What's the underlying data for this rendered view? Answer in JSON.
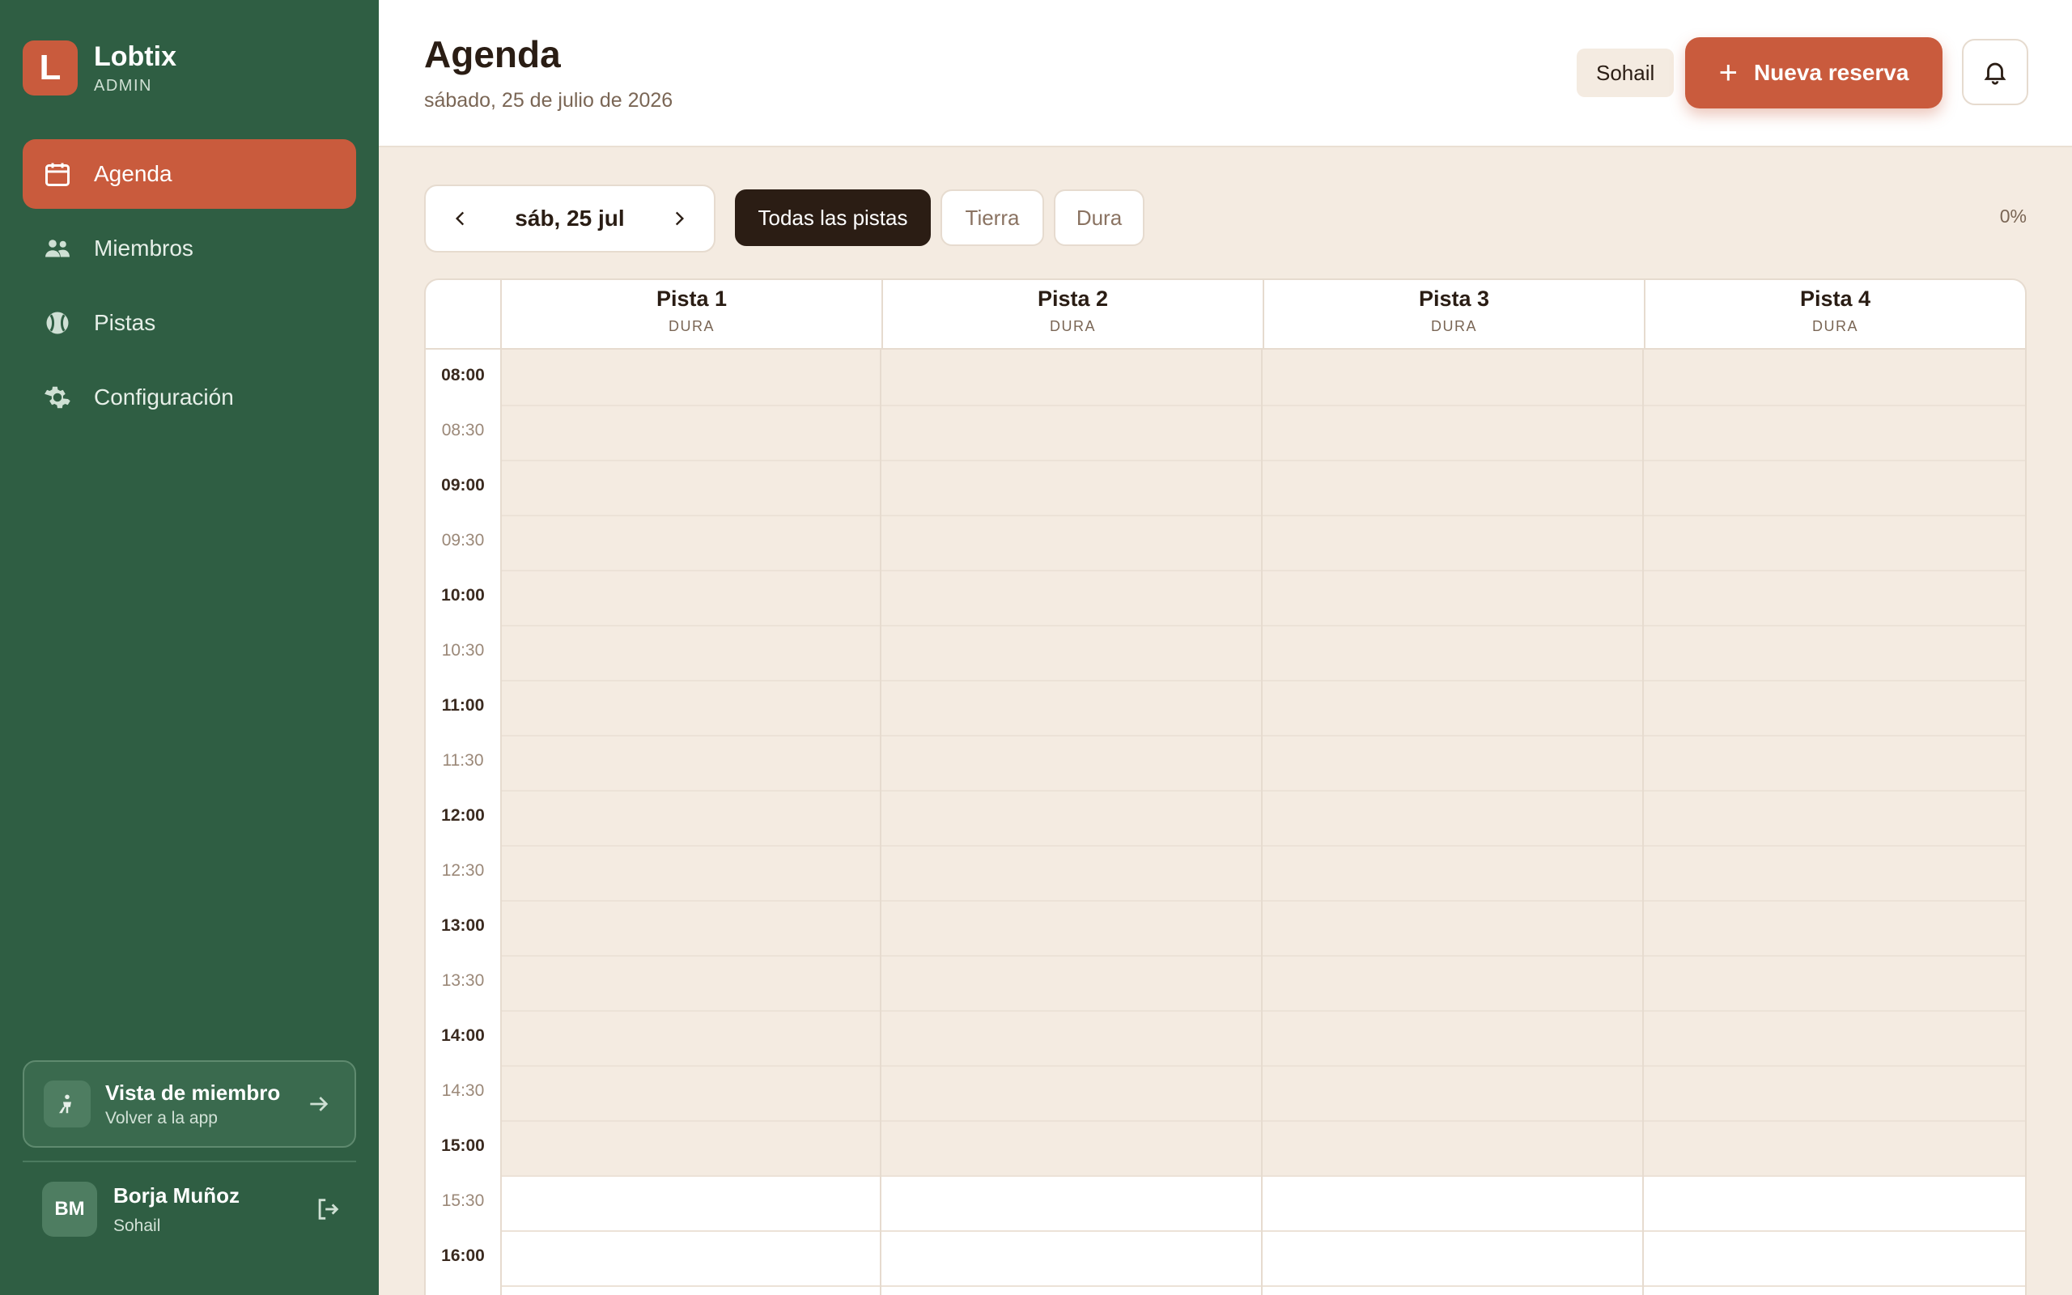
{
  "app": {
    "logo_letter": "L",
    "name": "Lobtix",
    "role": "ADMIN"
  },
  "nav": [
    {
      "label": "Agenda",
      "icon": "calendar-icon",
      "active": true
    },
    {
      "label": "Miembros",
      "icon": "people-icon",
      "active": false
    },
    {
      "label": "Pistas",
      "icon": "tennis-ball-icon",
      "active": false
    },
    {
      "label": "Configuración",
      "icon": "gear-icon",
      "active": false
    }
  ],
  "member_view": {
    "title": "Vista de miembro",
    "subtitle": "Volver a la app"
  },
  "user": {
    "initials": "BM",
    "name": "Borja Muñoz",
    "club": "Sohail"
  },
  "header": {
    "title": "Agenda",
    "date": "sábado, 25 de julio de 2026",
    "club_badge": "Sohail",
    "new_button": "Nueva reserva"
  },
  "toolbar": {
    "date_label": "sáb, 25 jul",
    "filters": [
      "Todas las pistas",
      "Tierra",
      "Dura"
    ],
    "active_filter": 0,
    "occupancy": "0%"
  },
  "courts": [
    {
      "name": "Pista 1",
      "type": "DURA"
    },
    {
      "name": "Pista 2",
      "type": "DURA"
    },
    {
      "name": "Pista 3",
      "type": "DURA"
    },
    {
      "name": "Pista 4",
      "type": "DURA"
    }
  ],
  "times": [
    "08:00",
    "08:30",
    "09:00",
    "09:30",
    "10:00",
    "10:30",
    "11:00",
    "11:30",
    "12:00",
    "12:30",
    "13:00",
    "13:30",
    "14:00",
    "14:30",
    "15:00",
    "15:30",
    "16:00"
  ],
  "colors": {
    "sidebar": "#2f5e43",
    "accent": "#c95b3d",
    "dark": "#2b1d14",
    "closed_slot": "#f4ebe1"
  }
}
